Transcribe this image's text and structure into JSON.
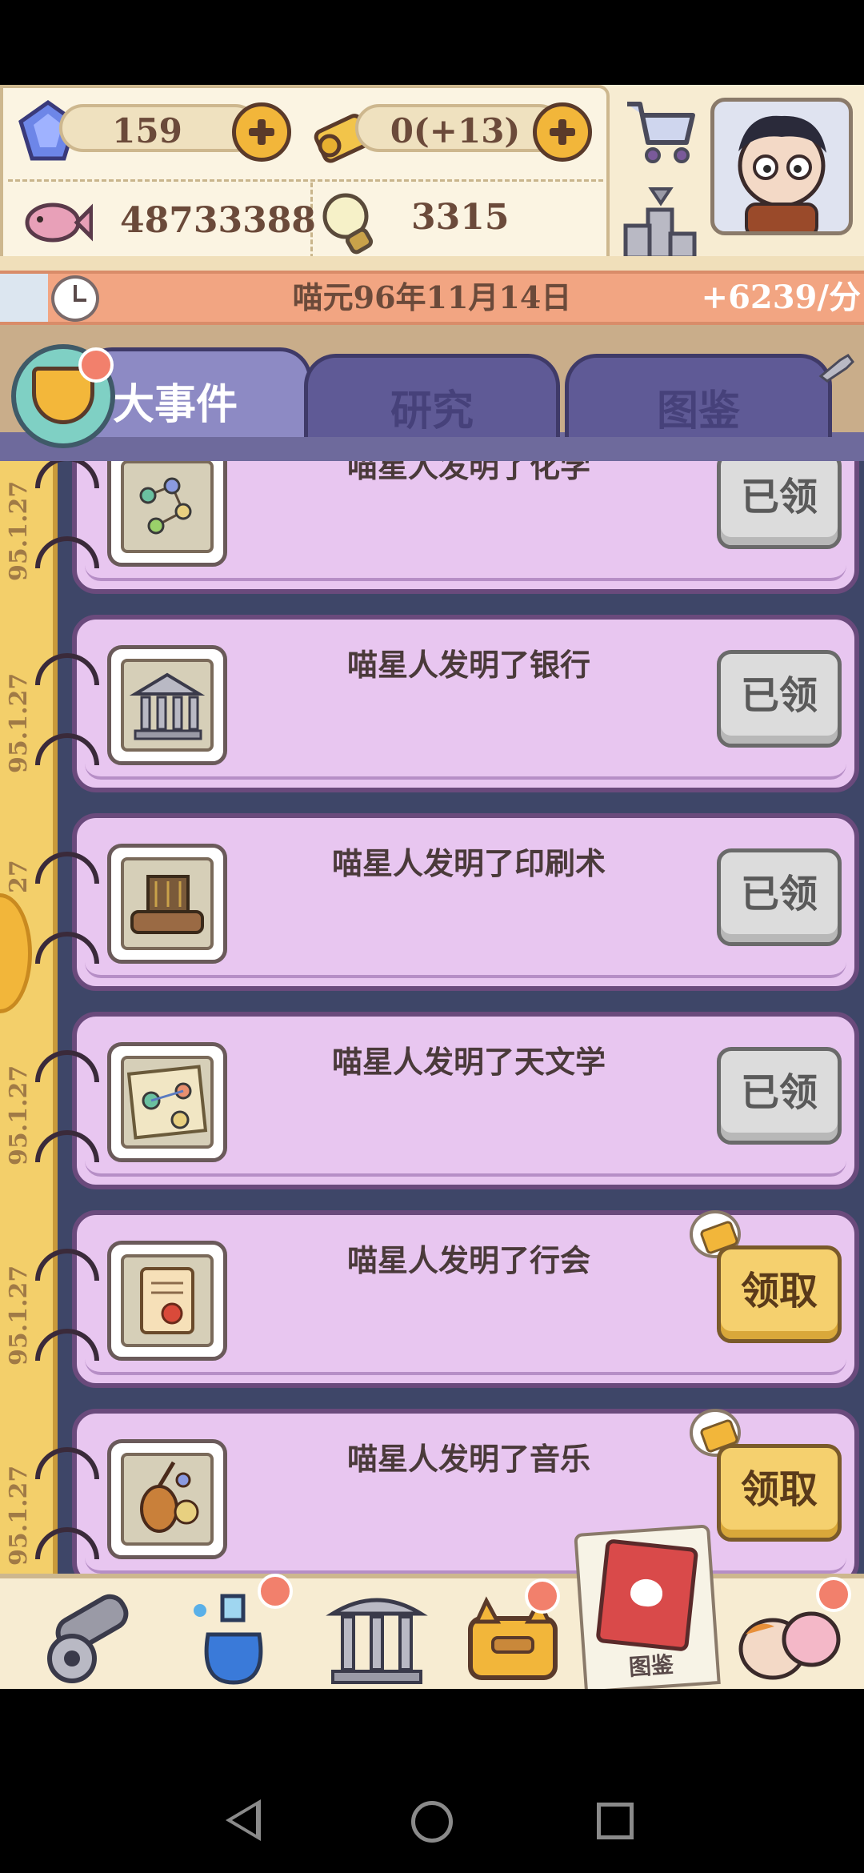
{
  "resources": {
    "gems": "159",
    "scrolls": "0(+13)",
    "fish": "48733388",
    "ideas": "3315"
  },
  "icons": {
    "gem": "gem-icon",
    "scroll": "scroll-icon",
    "fish": "fish-icon",
    "bulb": "lightbulb-icon",
    "cart": "shopping-cart-icon",
    "rank": "leaderboard-podium-icon",
    "clock": "clock-icon"
  },
  "date_bar": {
    "date": "喵元96年11月14日",
    "rate": "+6239/分"
  },
  "tabs": [
    {
      "label": "大事件",
      "active": true
    },
    {
      "label": "研究",
      "active": false
    },
    {
      "label": "图鉴",
      "active": false
    }
  ],
  "timeline_dates": [
    "95.1.27",
    "95.1.27",
    "27",
    "95.1.27",
    "95.1.27",
    "95.1.27"
  ],
  "events": [
    {
      "title": "喵星人发明了化学",
      "button": "已领"
    },
    {
      "title": "喵星人发明了银行",
      "button": "已领"
    },
    {
      "title": "喵星人发明了印刷术",
      "button": "已领"
    },
    {
      "title": "喵星人发明了天文学",
      "button": "已领"
    },
    {
      "title": "喵星人发明了行会",
      "button": "领取"
    },
    {
      "title": "喵星人发明了音乐",
      "button": "领取"
    }
  ],
  "bottom_nav": {
    "selected_label": "图鉴"
  },
  "colors": {
    "card_bg": "#e8c6f0",
    "claim_gold": "#f5d06e",
    "claimed_grey": "#dcdcdc",
    "date_bar": "#f2a582",
    "tab_active": "#8d8ac4"
  }
}
